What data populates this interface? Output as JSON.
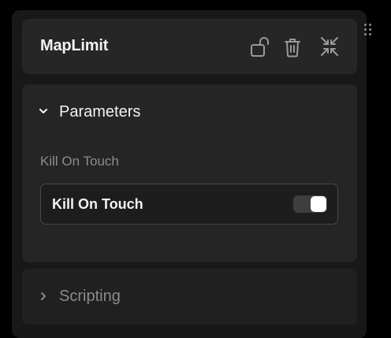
{
  "component": {
    "title": "MapLimit",
    "actions": {
      "lock_icon": "unlock-icon",
      "delete_icon": "trash-icon",
      "collapse_icon": "collapse-icon"
    }
  },
  "sections": {
    "parameters": {
      "title": "Parameters",
      "expanded": true,
      "field_label": "Kill On Touch",
      "toggle": {
        "label": "Kill On Touch",
        "value": true
      }
    },
    "scripting": {
      "title": "Scripting",
      "expanded": false
    }
  },
  "colors": {
    "panel_bg": "#181818",
    "card_bg": "#262626",
    "text_primary": "#f2f2f2",
    "text_muted": "#8d8d8d",
    "switch_track": "#3e3e3e",
    "switch_knob": "#ffffff"
  }
}
